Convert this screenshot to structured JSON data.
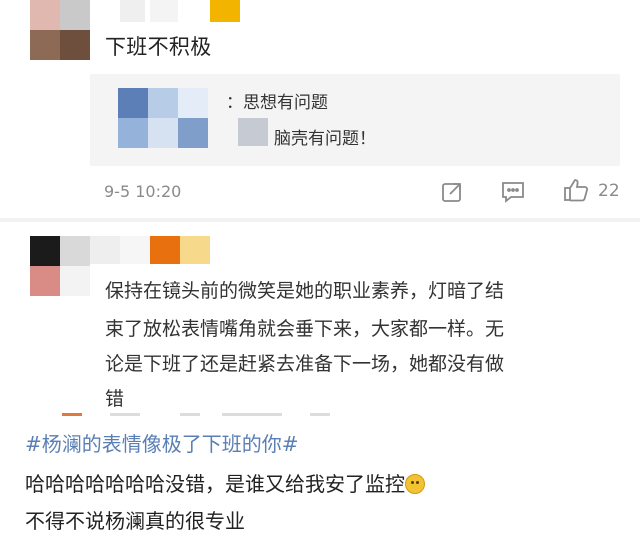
{
  "comment1": {
    "text": "下班不积极",
    "reply_line1": "：思想有问题",
    "reply_line2": "脑壳有问题！",
    "timestamp": "9-5 10:20",
    "likes": "22"
  },
  "comment2": {
    "lines": [
      "保持在镜头前的微笑是她的职业素养，灯暗了结",
      "束了放松表情嘴角就会垂下来，大家都一样。无",
      "论是下班了还是赶紧去准备下一场，她都没有做",
      "错"
    ]
  },
  "post": {
    "hashtag": "#杨澜的表情像极了下班的你#",
    "line1": "哈哈哈哈哈哈哈没错，是谁又给我安了监控",
    "line1_emoji": "doge-emoji",
    "line2": "不得不说杨澜真的很专业"
  },
  "icons": {
    "share": "share-icon",
    "comment": "comment-icon",
    "like": "thumbs-up-icon"
  },
  "colors": {
    "hashtag": "#5a7fb5",
    "meta": "#8a8a8a"
  }
}
